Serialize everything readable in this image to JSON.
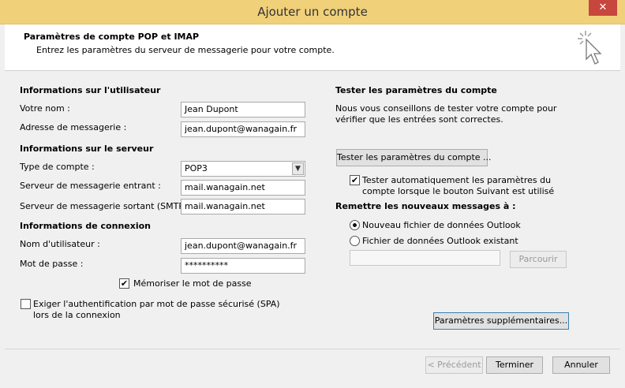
{
  "window": {
    "title": "Ajouter un compte",
    "close_glyph": "✕"
  },
  "header": {
    "title": "Paramètres de compte POP et IMAP",
    "subtitle": "Entrez les paramètres du serveur de messagerie pour votre compte."
  },
  "user_info": {
    "heading": "Informations sur l'utilisateur",
    "name_label": "Votre nom :",
    "name_value": "Jean Dupont",
    "email_label": "Adresse de messagerie :",
    "email_value": "jean.dupont@wanagain.fr"
  },
  "server_info": {
    "heading": "Informations sur le serveur",
    "account_type_label": "Type de compte :",
    "account_type_value": "POP3",
    "incoming_label": "Serveur de messagerie entrant :",
    "incoming_value": "mail.wanagain.net",
    "outgoing_label": "Serveur de messagerie sortant (SMTP) :",
    "outgoing_value": "mail.wanagain.net"
  },
  "login_info": {
    "heading": "Informations de connexion",
    "username_label": "Nom d'utilisateur :",
    "username_value": "jean.dupont@wanagain.fr",
    "password_label": "Mot de passe :",
    "password_value": "**********",
    "remember_label": "Mémoriser le mot de passe",
    "spa_label_line1": "Exiger l'authentification par mot de passe sécurisé (SPA)",
    "spa_label_line2": "lors de la connexion"
  },
  "test_settings": {
    "heading": "Tester les paramètres du compte",
    "desc_line1": "Nous vous conseillons de tester votre compte pour",
    "desc_line2": "vérifier que les entrées sont correctes.",
    "test_button": "Tester les paramètres du compte ...",
    "auto_test_line1": "Tester automatiquement les paramètres du",
    "auto_test_line2": "compte lorsque le bouton Suivant est utilisé"
  },
  "delivery": {
    "heading": "Remettre les nouveaux messages à :",
    "new_file_label": "Nouveau fichier de données Outlook",
    "existing_file_label": "Fichier de données Outlook existant",
    "existing_file_value": "",
    "browse_button": "Parcourir"
  },
  "more_settings_button": "Paramètres supplémentaires...",
  "footer": {
    "back_button": "< Précédent",
    "finish_button": "Terminer",
    "cancel_button": "Annuler"
  },
  "checks": {
    "checked_glyph": "✔"
  }
}
